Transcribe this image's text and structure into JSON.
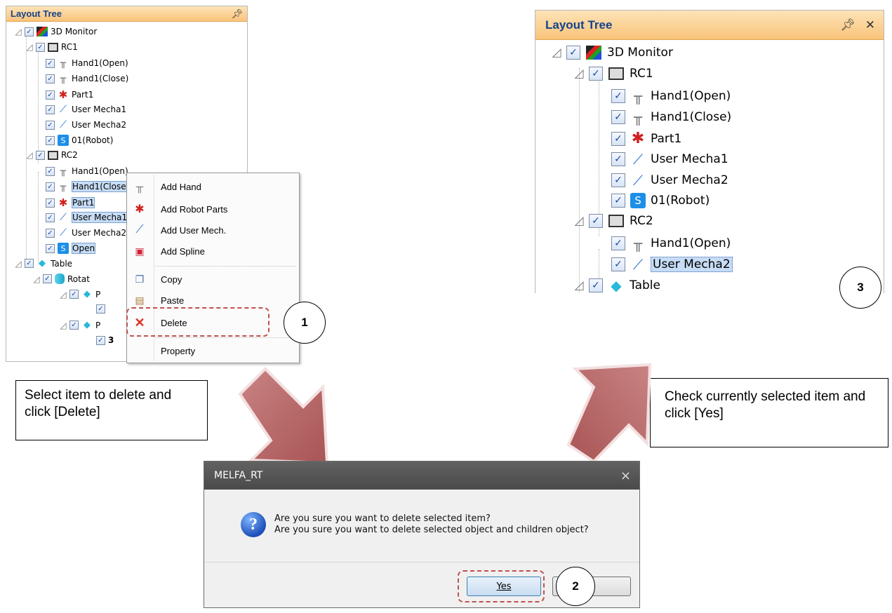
{
  "left_panel": {
    "title": "Layout Tree",
    "pin": "⯕",
    "rows": [
      "3D Monitor",
      "RC1",
      "Hand1(Open)",
      "Hand1(Close)",
      "Part1",
      "User Mecha1",
      "User Mecha2",
      "01(Robot)",
      "RC2",
      "Hand1(Open)",
      "Hand1(Close)",
      "Part1",
      "User Mecha1",
      "User Mecha2",
      "Open",
      "Table",
      "Rotat",
      "P",
      "P",
      "3"
    ]
  },
  "context_menu": {
    "items": [
      "Add Hand",
      "Add Robot Parts",
      "Add User Mech.",
      "Add Spline",
      "Copy",
      "Paste",
      "Delete",
      "Property"
    ]
  },
  "right_panel": {
    "title": "Layout Tree",
    "pin": "⯕",
    "close": "✕",
    "rows": [
      "3D Monitor",
      "RC1",
      "Hand1(Open)",
      "Hand1(Close)",
      "Part1",
      "User Mecha1",
      "User Mecha2",
      "01(Robot)",
      "RC2",
      "Hand1(Open)",
      "User Mecha2",
      "Table"
    ]
  },
  "notes": {
    "left": "Select item to delete and click [Delete]",
    "right": "Check currently selected item and click [Yes]"
  },
  "steps": [
    "1",
    "2",
    "3"
  ],
  "dialog": {
    "title": "MELFA_RT",
    "close": "×",
    "line1": "Are you sure you want to delete selected item?",
    "line2": "Are you sure you want to delete selected object and children object?",
    "yes": "Yes",
    "no": ""
  },
  "colors": {
    "arrow": "#b96767",
    "highlight": "#c0504d",
    "panel_header": "#f9c47a"
  }
}
